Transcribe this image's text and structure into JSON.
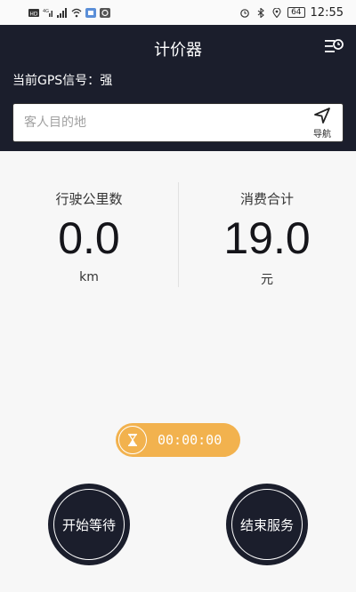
{
  "status_bar": {
    "left_icons": [
      "hd-icon",
      "signal-4g-icon",
      "signal-bars-icon",
      "wifi-icon",
      "app-icon-1",
      "app-icon-2"
    ],
    "battery": "64",
    "time": "12:55"
  },
  "header": {
    "title": "计价器",
    "gps_label": "当前GPS信号：",
    "gps_value": "强"
  },
  "destination": {
    "placeholder": "客人目的地",
    "value": "",
    "nav_label": "导航"
  },
  "metrics": {
    "distance_label": "行驶公里数",
    "distance_value": "0.0",
    "distance_unit": "km",
    "fare_label": "消费合计",
    "fare_value": "19.0",
    "fare_unit": "元"
  },
  "timer": {
    "value": "00:00:00"
  },
  "buttons": {
    "start_wait": "开始等待",
    "end_service": "结束服务"
  },
  "colors": {
    "header_bg": "#1b1e2c",
    "timer_accent": "#f2b24e",
    "page_bg": "#f7f7f7"
  }
}
